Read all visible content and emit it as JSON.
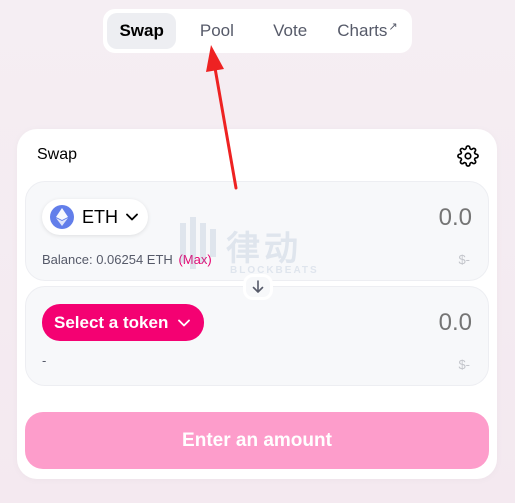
{
  "nav": {
    "items": [
      {
        "label": "Swap",
        "active": true
      },
      {
        "label": "Pool",
        "active": false
      },
      {
        "label": "Vote",
        "active": false
      },
      {
        "label": "Charts",
        "active": false,
        "external_icon": "arrow-up-right-icon"
      }
    ],
    "external_glyph": "↗"
  },
  "card": {
    "title": "Swap",
    "settings_icon": "gear-icon"
  },
  "input_panel": {
    "token_symbol": "ETH",
    "token_icon": "ethereum-icon",
    "amount_placeholder": "0.0",
    "balance_label": "Balance: 0.06254 ETH",
    "max_label": "(Max)",
    "usd_value": "$-"
  },
  "swap_direction_icon": "arrow-down-icon",
  "output_panel": {
    "select_label": "Select a token",
    "amount_placeholder": "0.0",
    "balance_label": "-",
    "usd_value": "$-"
  },
  "action_button": {
    "label": "Enter an amount",
    "disabled": true
  },
  "watermark": {
    "text_cn": "律动",
    "text_en": "BLOCKBEATS"
  },
  "colors": {
    "accent": "#f40172",
    "button_disabled": "#fd9dcb",
    "annotation": "#ee2222"
  }
}
